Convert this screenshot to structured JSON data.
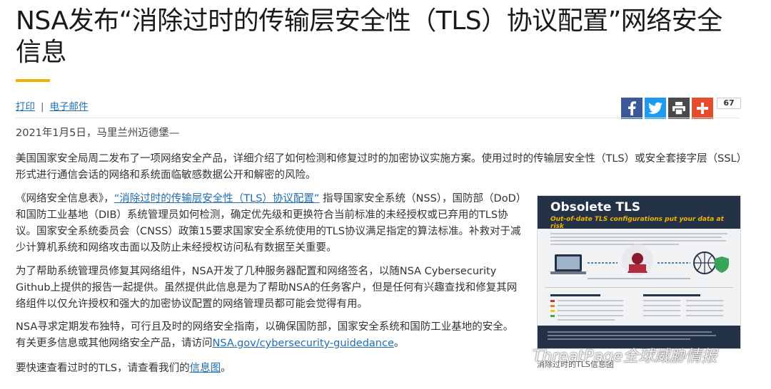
{
  "article": {
    "title": "NSA发布“消除过时的传输层安全性（TLS）协议配置”网络安全信息",
    "toolbar": {
      "print": "打印",
      "separator": "|",
      "email": "电子邮件"
    },
    "share": {
      "count": "67"
    },
    "date": "2021年1月5日，马里兰州迈德堡—",
    "p1": "美国国家安全局周二发布了一项网络安全产品，详细介绍了如何检测和修复过时的加密协议实施方案。使用过时的传输层安全性（TLS）或安全套接字层（SSL）形式进行通信会话的网络和系统面临敏感数据公开和解密的风险。",
    "p2_a": "《网络安全信息表》，",
    "p2_link": "“消除过时的传输层安全性（TLS）协议配置”",
    "p2_b": " 指导国家安全系统（NSS），国防部（DoD）和国防工业基地（DIB）系统管理员如何检测，确定优先级和更换符合当前标准的未经授权或已弃用的TLS协议。国家安全系统委员会（CNSS）政策15要求国家安全系统使用的TLS协议满足指定的算法标准。补救对于减少计算机系统和网络攻击面以及防止未经授权访问私有数据至关重要。",
    "p3": "为了帮助系统管理员修复其网络组件，NSA开发了几种服务器配置和网络签名，以随NSA Cybersecurity Github上提供的报告一起提供。虽然提供此信息是为了帮助NSA的任务客户，但是任何有兴趣查找和修复其网络组件以仅允许授权和强大的加密协议配置的网络管理员都可能会觉得有用。",
    "p4_a": "NSA寻求定期发布独特，可行且及时的网络安全指南，以确保国防部，国家安全系统和国防工业基地的安全。有关更多信息或其他网络安全产品，请访问",
    "p4_link": "NSA.gov/cybersecurity-guidedance",
    "p4_b": "。",
    "p5_a": "要快速查看过时的TLS，请查看我们的",
    "p5_link": "信息图",
    "p5_b": "。"
  },
  "infographic": {
    "title": "Obsolete TLS",
    "subtitle": "Out-of-date TLS configurations put your data at risk",
    "caption": "消除过时的TLS信息图"
  },
  "watermark": {
    "text": "ThreatPage全球威胁情报"
  },
  "colors": {
    "accent": "#f0b400",
    "link": "#1f6fb2",
    "facebook": "#3b5998",
    "twitter": "#1d9bf0",
    "plus": "#e74c2d"
  },
  "icons": [
    "facebook-icon",
    "twitter-icon",
    "print-icon",
    "plus-icon",
    "wechat-icon"
  ]
}
